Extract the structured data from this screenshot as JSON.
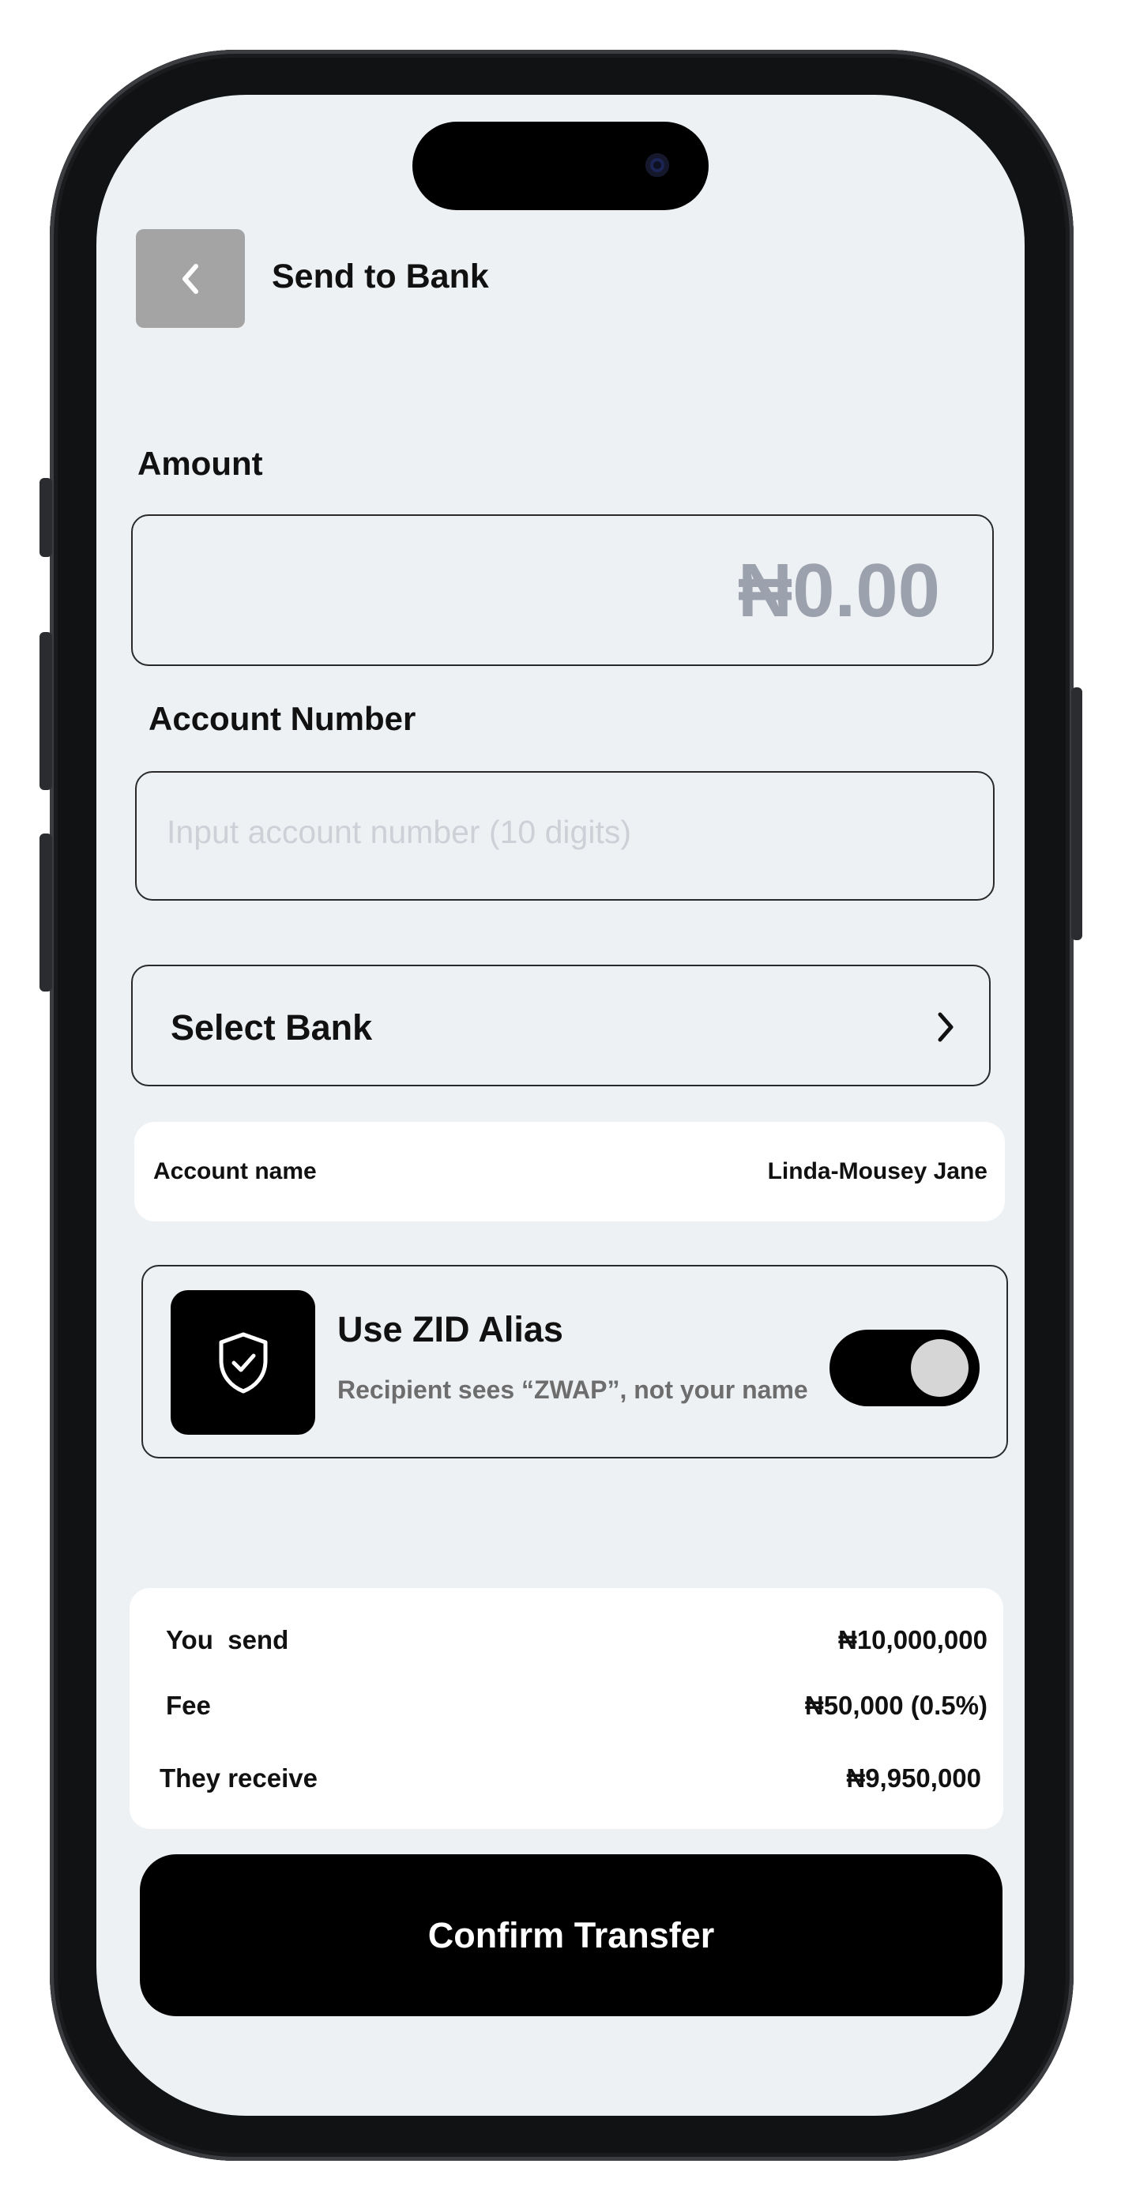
{
  "header": {
    "title": "Send to Bank"
  },
  "amount": {
    "label": "Amount",
    "placeholder": "₦0.00"
  },
  "account_number": {
    "label": "Account Number",
    "placeholder": "Input account number (10 digits)"
  },
  "bank": {
    "label": "Select Bank"
  },
  "account_name": {
    "label": "Account name",
    "value": "Linda-Mousey Jane"
  },
  "alias": {
    "title": "Use ZID Alias",
    "subtitle": "Recipient sees “ZWAP”, not your name",
    "enabled": true
  },
  "summary": {
    "rows": [
      {
        "label": "You  send",
        "value": "₦10,000,000"
      },
      {
        "label": "Fee",
        "value": "₦50,000 (0.5%)"
      },
      {
        "label": "They receive",
        "value": "₦9,950,000"
      }
    ]
  },
  "confirm": {
    "label": "Confirm Transfer"
  },
  "colors": {
    "screen_bg": "#eef1f4",
    "primary": "#000000",
    "placeholder": "#9ba2ae",
    "back_button": "#a4a4a4"
  },
  "icons": {
    "back": "chevron-left-icon",
    "bank": "chevron-right-icon",
    "alias": "shield-check-icon"
  }
}
